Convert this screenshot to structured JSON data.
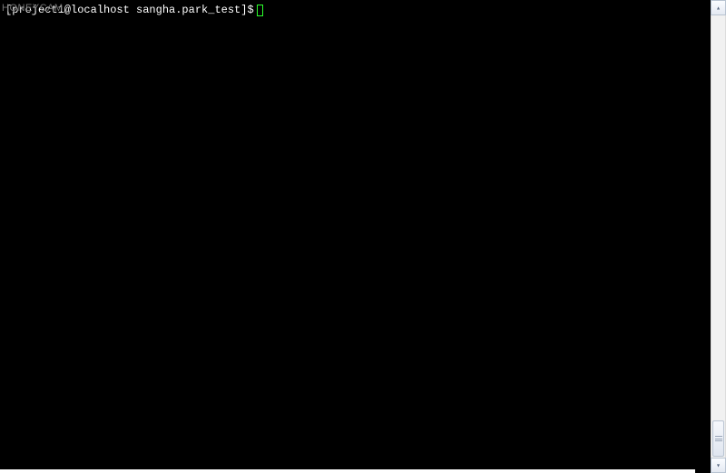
{
  "watermark": "HONEYCAM",
  "terminal": {
    "prompt": "[project1@localhost sangha.park_test]$"
  },
  "scrollbar": {
    "up_glyph": "▴",
    "down_glyph": "▾"
  }
}
